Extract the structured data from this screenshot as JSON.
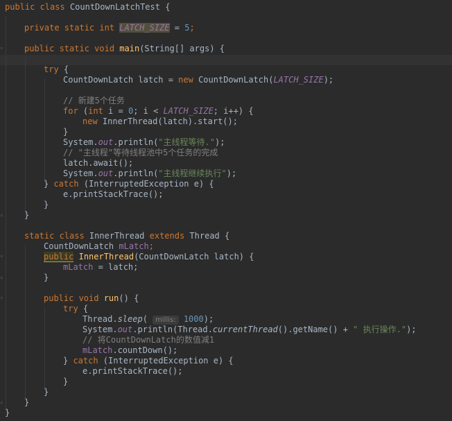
{
  "code": {
    "l1_kw": "public class ",
    "l1_name": "CountDownLatchTest {",
    "l2_kw": "private static int ",
    "l2_field": "LATCH_SIZE",
    "l2_eq": " = ",
    "l2_num": "5",
    "l2_end": ";",
    "l3_kw": "public static void ",
    "l3_fn": "main",
    "l3_rest": "(String[] args) {",
    "l4_try": "try",
    "l4_brace": " {",
    "l5_a": "CountDownLatch latch = ",
    "l5_new": "new",
    "l5_b": " CountDownLatch(",
    "l5_field": "LATCH_SIZE",
    "l5_c": ");",
    "l6_cmt": "// 新建5个任务",
    "l7_for": "for",
    "l7_a": " (",
    "l7_int": "int",
    "l7_b": " i = ",
    "l7_zero": "0",
    "l7_c": "; i < ",
    "l7_field": "LATCH_SIZE",
    "l7_d": "; i++) {",
    "l8_new": "new",
    "l8_rest": " InnerThread(latch).start();",
    "l9": "}",
    "l10_a": "System.",
    "l10_out": "out",
    "l10_b": ".println(",
    "l10_str": "\"主线程等待.\"",
    "l10_c": ");",
    "l11_cmt": "// \"主线程\"等待线程池中5个任务的完成",
    "l12": "latch.await();",
    "l13_a": "System.",
    "l13_out": "out",
    "l13_b": ".println(",
    "l13_str": "\"主线程继续执行\"",
    "l13_c": ");",
    "l14_a": "} ",
    "l14_catch": "catch",
    "l14_b": " (InterruptedException e) {",
    "l15": "e.printStackTrace();",
    "l16": "}",
    "l17": "}",
    "l18_kw": "static class ",
    "l18_name": "InnerThread ",
    "l18_ext": "extends",
    "l18_rest": " Thread {",
    "l19_a": "CountDownLatch ",
    "l19_field": "mLatch",
    "l19_b": ";",
    "l20_pub": "public",
    "l20_fn": "InnerThread",
    "l20_rest": "(CountDownLatch latch) {",
    "l21_field": "mLatch",
    "l21_rest": " = latch;",
    "l22": "}",
    "l23_kw": "public void ",
    "l23_fn": "run",
    "l23_rest": "() {",
    "l24_try": "try",
    "l24_brace": " {",
    "l25_a": "Thread.",
    "l25_sleep": "sleep",
    "l25_b": "( ",
    "l25_hint": "millis:",
    "l25_num": " 1000",
    "l25_c": ");",
    "l26_a": "System.",
    "l26_out": "out",
    "l26_b": ".println(Thread.",
    "l26_ct": "currentThread",
    "l26_c": "().getName() + ",
    "l26_str": "\" 执行操作.\"",
    "l26_d": ");",
    "l27_cmt": "// 将CountDownLatch的数值减1",
    "l28_field": "mLatch",
    "l28_rest": ".countDown();",
    "l29_a": "} ",
    "l29_catch": "catch",
    "l29_b": " (InterruptedException e) {",
    "l30": "e.printStackTrace();",
    "l31": "}",
    "l32": "}",
    "l33": "}"
  }
}
